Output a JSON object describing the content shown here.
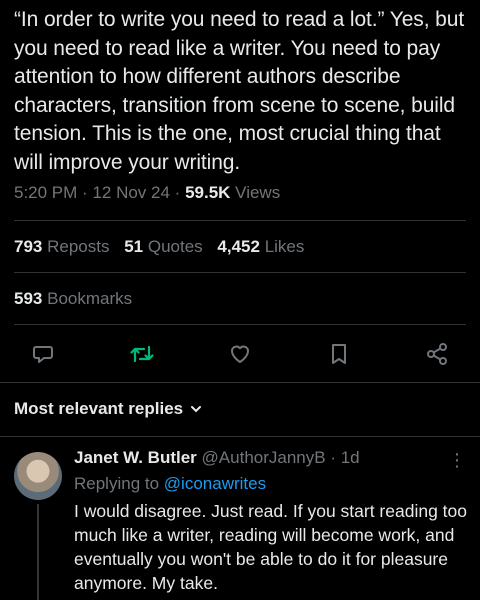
{
  "tweet": {
    "text": "“In order to write you need to read a lot.” Yes, but you need to read like a writer. You need to pay attention to how different authors describe characters, transition from scene to scene, build tension. This is the one, most crucial thing that will improve your writing.",
    "time": "5:20 PM",
    "date": "12 Nov 24",
    "views_count": "59.5K",
    "views_label": "Views"
  },
  "stats": {
    "reposts_count": "793",
    "reposts_label": "Reposts",
    "quotes_count": "51",
    "quotes_label": "Quotes",
    "likes_count": "4,452",
    "likes_label": "Likes",
    "bookmarks_count": "593",
    "bookmarks_label": "Bookmarks"
  },
  "actions": {
    "icons": [
      "reply-icon",
      "repost-icon",
      "like-icon",
      "bookmark-icon",
      "share-icon"
    ],
    "colors": {
      "icon": "#71767b",
      "repost": "#00ba7c"
    }
  },
  "replies": {
    "sort_label": "Most relevant replies"
  },
  "reply": {
    "name": "Janet W. Butler",
    "handle": "@AuthorJannyB",
    "age": "1d",
    "replying_prefix": "Replying to",
    "replying_handle": "@iconawrites",
    "text": "I would disagree. Just read. If you start reading too much like a writer, reading will become work, and eventually you won't be able to do it for pleasure anymore. My take."
  },
  "colors": {
    "background": "#000000",
    "text": "#e7e9ea",
    "muted": "#71767b",
    "link": "#1d9bf0",
    "divider": "#2f3336"
  }
}
